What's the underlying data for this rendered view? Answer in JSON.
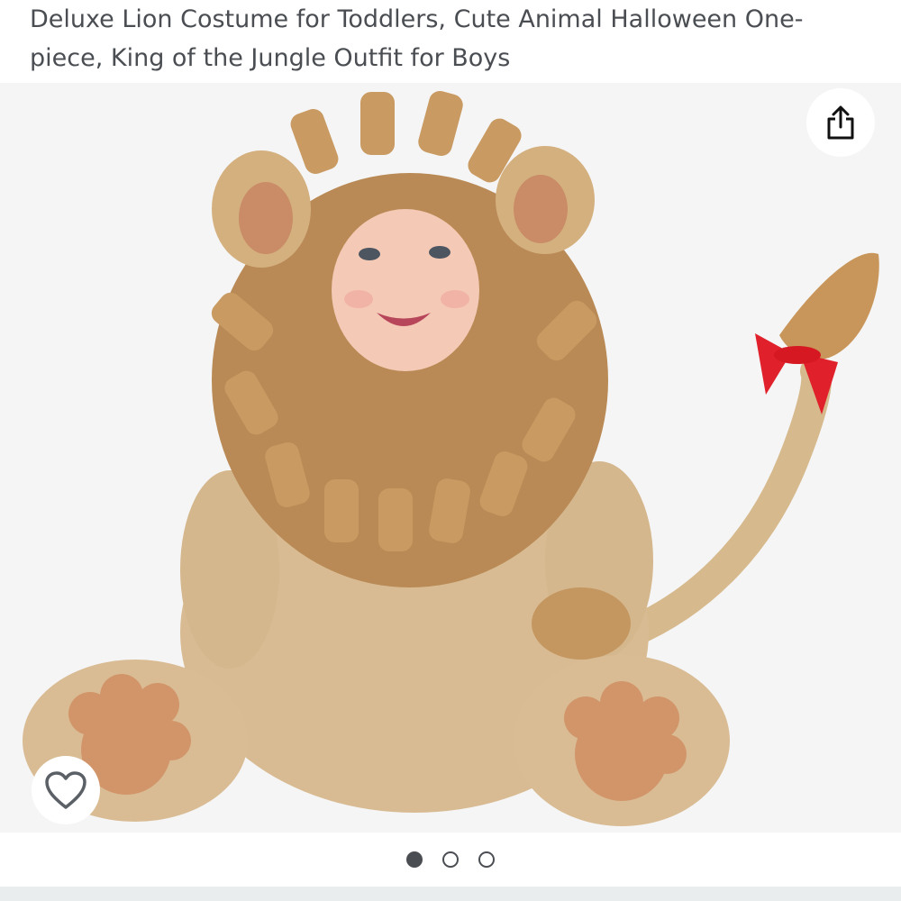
{
  "product": {
    "title": "Deluxe Lion Costume for Toddlers, Cute Animal Halloween One-piece, King of the Jungle Outfit for Boys"
  },
  "gallery": {
    "image_count": 3,
    "active_index": 0,
    "dots": [
      {
        "active": true
      },
      {
        "active": false
      },
      {
        "active": false
      }
    ]
  },
  "actions": {
    "share_icon": "share-icon",
    "wishlist_icon": "heart-outline-icon"
  },
  "colors": {
    "text": "#4a4d52",
    "image_background": "#f5f5f5",
    "bottom_band": "#eaeded"
  }
}
